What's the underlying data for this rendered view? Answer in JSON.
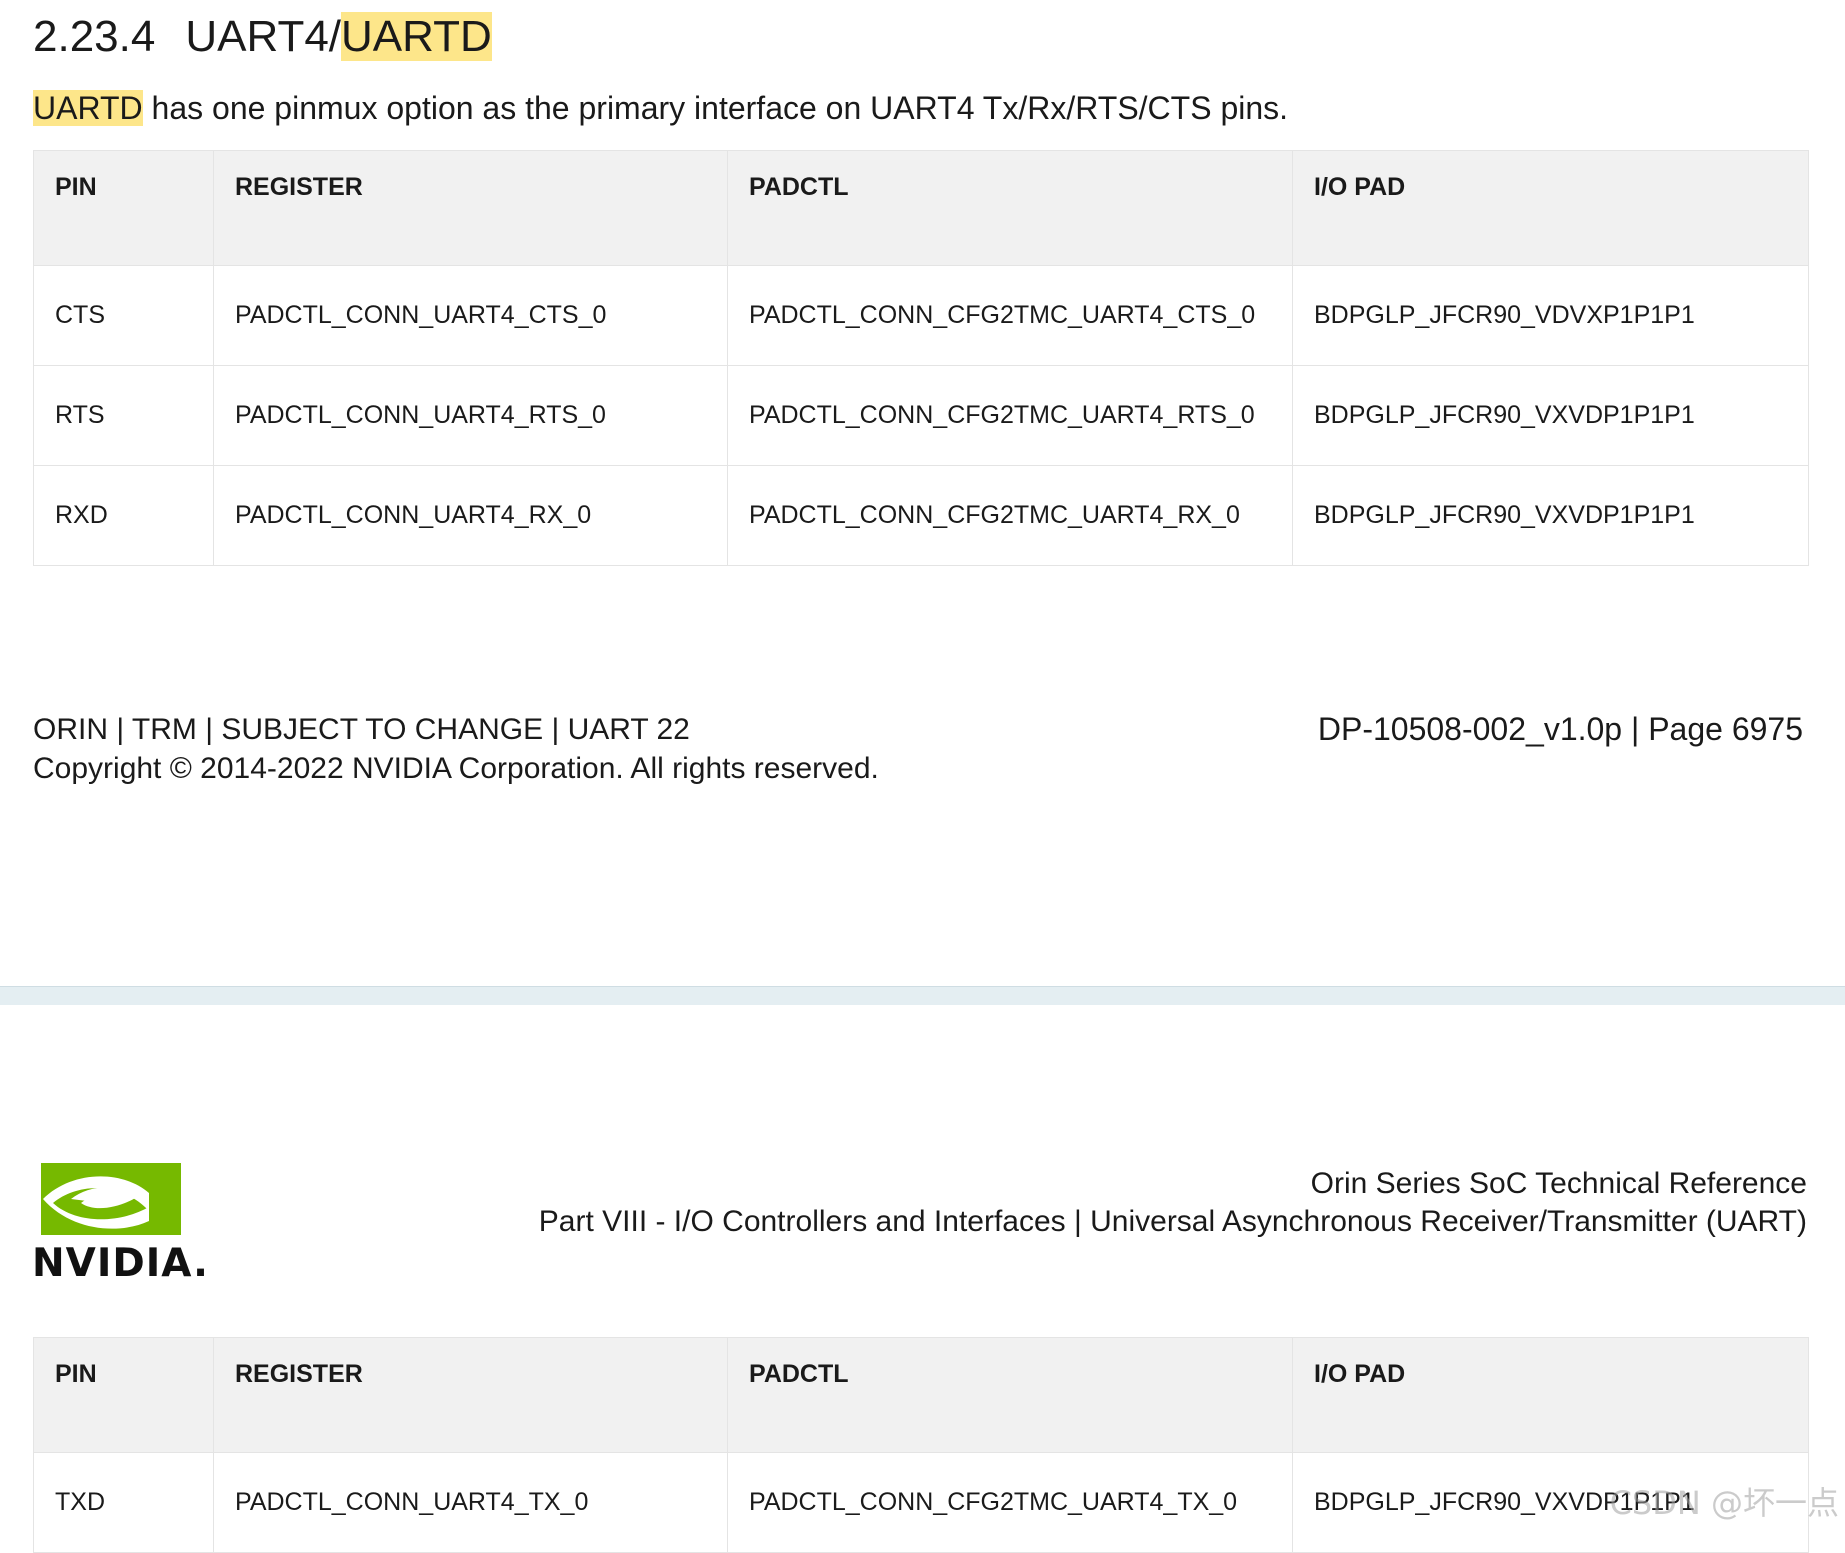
{
  "section": {
    "number": "2.23.4",
    "title_plain": "UART4/",
    "title_highlight": "UARTD"
  },
  "intro": {
    "highlight": "UARTD",
    "text": " has one pinmux option as the primary interface on UART4 Tx/Rx/RTS/CTS pins."
  },
  "table_headers": {
    "pin": "PIN",
    "register": "REGISTER",
    "padctl": "PADCTL",
    "io_pad": "I/O  PAD"
  },
  "table_rows_page1": [
    {
      "pin": "CTS",
      "register": "PADCTL_CONN_UART4_CTS_0",
      "padctl": "PADCTL_CONN_CFG2TMC_UART4_CTS_0",
      "io_pad": "BDPGLP_JFCR90_VDVXP1P1P1"
    },
    {
      "pin": "RTS",
      "register": "PADCTL_CONN_UART4_RTS_0",
      "padctl": "PADCTL_CONN_CFG2TMC_UART4_RTS_0",
      "io_pad": "BDPGLP_JFCR90_VXVDP1P1P1"
    },
    {
      "pin": "RXD",
      "register": "PADCTL_CONN_UART4_RX_0",
      "padctl": "PADCTL_CONN_CFG2TMC_UART4_RX_0",
      "io_pad": "BDPGLP_JFCR90_VXVDP1P1P1"
    }
  ],
  "table_rows_page2": [
    {
      "pin": "TXD",
      "register": "PADCTL_CONN_UART4_TX_0",
      "padctl": "PADCTL_CONN_CFG2TMC_UART4_TX_0",
      "io_pad": "BDPGLP_JFCR90_VXVDP1P1P1"
    }
  ],
  "footer": {
    "line1": "ORIN | TRM | SUBJECT TO CHANGE | UART  22",
    "line2": "Copyright © 2014-2022 NVIDIA Corporation. All rights reserved.",
    "doc_page": "DP-10508-002_v1.0p | Page 6975"
  },
  "header": {
    "logo_word": "NVIDIA.",
    "line1": "Orin Series SoC Technical Reference",
    "line2": "Part VIII - I/O Controllers and Interfaces | Universal Asynchronous Receiver/Transmitter (UART)"
  },
  "watermark": "CSDN @坏一点",
  "colors": {
    "highlight": "#fde68a",
    "header_bg": "#f1f1f1",
    "nvidia_green": "#76b900"
  }
}
